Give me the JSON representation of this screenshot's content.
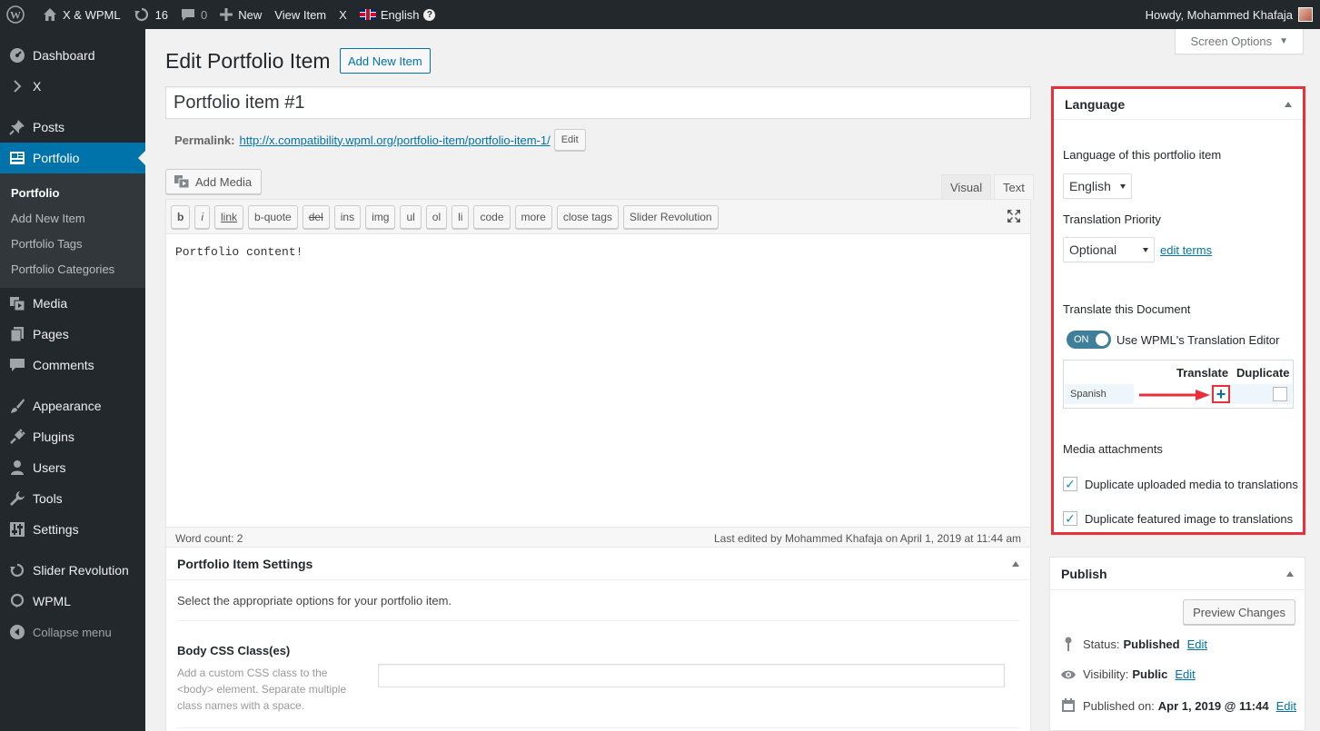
{
  "adminbar": {
    "site_name": "X & WPML",
    "updates_count": "16",
    "comments_count": "0",
    "new_label": "New",
    "view_item_label": "View Item",
    "x_label": "X",
    "language_label": "English",
    "howdy": "Howdy, Mohammed Khafaja"
  },
  "sidebar": {
    "items_top": [
      {
        "label": "Dashboard",
        "icon": "dashboard-icon"
      },
      {
        "label": "X",
        "icon": "chevron-right-icon"
      }
    ],
    "items_mid": [
      {
        "label": "Posts",
        "icon": "pin-icon"
      },
      {
        "label": "Portfolio",
        "icon": "portfolio-icon"
      }
    ],
    "portfolio_submenu": [
      "Portfolio",
      "Add New Item",
      "Portfolio Tags",
      "Portfolio Categories"
    ],
    "items_after": [
      "Media",
      "Pages",
      "Comments"
    ],
    "items_bottom": [
      "Appearance",
      "Plugins",
      "Users",
      "Tools",
      "Settings"
    ],
    "items_plugins": [
      "Slider Revolution",
      "WPML"
    ],
    "collapse": "Collapse menu"
  },
  "page": {
    "screen_options": "Screen Options",
    "title": "Edit Portfolio Item",
    "add_new": "Add New Item",
    "post_title": "Portfolio item #1",
    "permalink_label": "Permalink:",
    "permalink_base": "http://x.compatibility.wpml.org/portfolio-item/",
    "permalink_slug": "portfolio-item-1/",
    "permalink_edit": "Edit"
  },
  "editor": {
    "add_media": "Add Media",
    "tab_visual": "Visual",
    "tab_text": "Text",
    "quicktags": [
      "b",
      "i",
      "link",
      "b-quote",
      "del",
      "ins",
      "img",
      "ul",
      "ol",
      "li",
      "code",
      "more",
      "close tags",
      "Slider Revolution"
    ],
    "content": "Portfolio content!",
    "word_count": "Word count: 2",
    "last_edited": "Last edited by Mohammed Khafaja on April 1, 2019 at 11:44 am"
  },
  "portfolio_settings": {
    "title": "Portfolio Item Settings",
    "description": "Select the appropriate options for your portfolio item.",
    "body_css_label": "Body CSS Class(es)",
    "body_css_help": "Add a custom CSS class to the <body> element. Separate multiple class names with a space."
  },
  "language_box": {
    "title": "Language",
    "lang_of_item_label": "Language of this portfolio item",
    "lang_selected": "English",
    "priority_label": "Translation Priority",
    "priority_selected": "Optional",
    "edit_terms": "edit terms",
    "translate_doc_label": "Translate this Document",
    "toggle_state": "ON",
    "toggle_label": "Use WPML's Translation Editor",
    "col_translate": "Translate",
    "col_duplicate": "Duplicate",
    "row_language": "Spanish",
    "media_label": "Media attachments",
    "dup_media": "Duplicate uploaded media to translations",
    "dup_featured": "Duplicate featured image to translations",
    "accent_color": "#e8303b"
  },
  "publish_box": {
    "title": "Publish",
    "preview": "Preview Changes",
    "status_label": "Status:",
    "status_value": "Published",
    "visibility_label": "Visibility:",
    "visibility_value": "Public",
    "published_label": "Published on:",
    "published_value": "Apr 1, 2019 @ 11:44",
    "edit": "Edit"
  }
}
